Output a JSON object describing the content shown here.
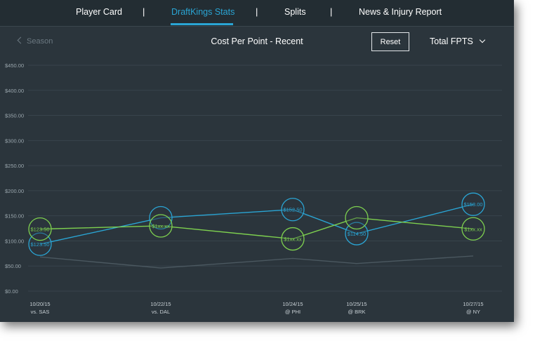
{
  "nav": {
    "tabs": [
      {
        "label": "Player Card",
        "active": false
      },
      {
        "label": "DraftKings Stats",
        "active": true
      },
      {
        "label": "Splits",
        "active": false
      },
      {
        "label": "News & Injury Report",
        "active": false
      }
    ],
    "separator": "|"
  },
  "toolbar": {
    "back_label": "Season",
    "title": "Cost Per Point - Recent",
    "reset_label": "Reset",
    "metric_label": "Total FPTS"
  },
  "colors": {
    "accent": "#2aa5d4",
    "green": "#7ed14f",
    "gray_series": "#4b5860",
    "background": "#2b353c"
  },
  "chart_data": {
    "type": "line",
    "ylim": [
      0,
      450
    ],
    "yticks": [
      "$0.00",
      "$50.00",
      "$100.00",
      "$150.00",
      "$200.00",
      "$250.00",
      "$300.00",
      "$350.00",
      "$400.00",
      "$450.00"
    ],
    "x_dates": [
      "10/20/15",
      "10/22/15",
      "10/24/15",
      "10/25/15",
      "10/27/15"
    ],
    "x_opponents": [
      "vs. SAS",
      "vs. DAL",
      "@ PHI",
      "@ BRK",
      "@ NY"
    ],
    "grid": true,
    "series": [
      {
        "color": "#2aa5d4",
        "values": [
          93.5,
          146,
          162.5,
          114.5,
          173
        ],
        "labels": [
          "$123.50",
          "",
          "$152.50",
          "$114.50",
          "$158.00"
        ]
      },
      {
        "color": "#7ed14f",
        "values": [
          123.5,
          130,
          104,
          146,
          124
        ],
        "labels": [
          "$123.50",
          "$1xx.xx",
          "$1xx.xx",
          "",
          "$1xx.xx"
        ]
      },
      {
        "color": "#4b5860",
        "values": [
          68,
          46,
          65,
          55,
          70
        ],
        "labels": [
          "",
          "",
          "",
          "",
          ""
        ]
      }
    ]
  }
}
